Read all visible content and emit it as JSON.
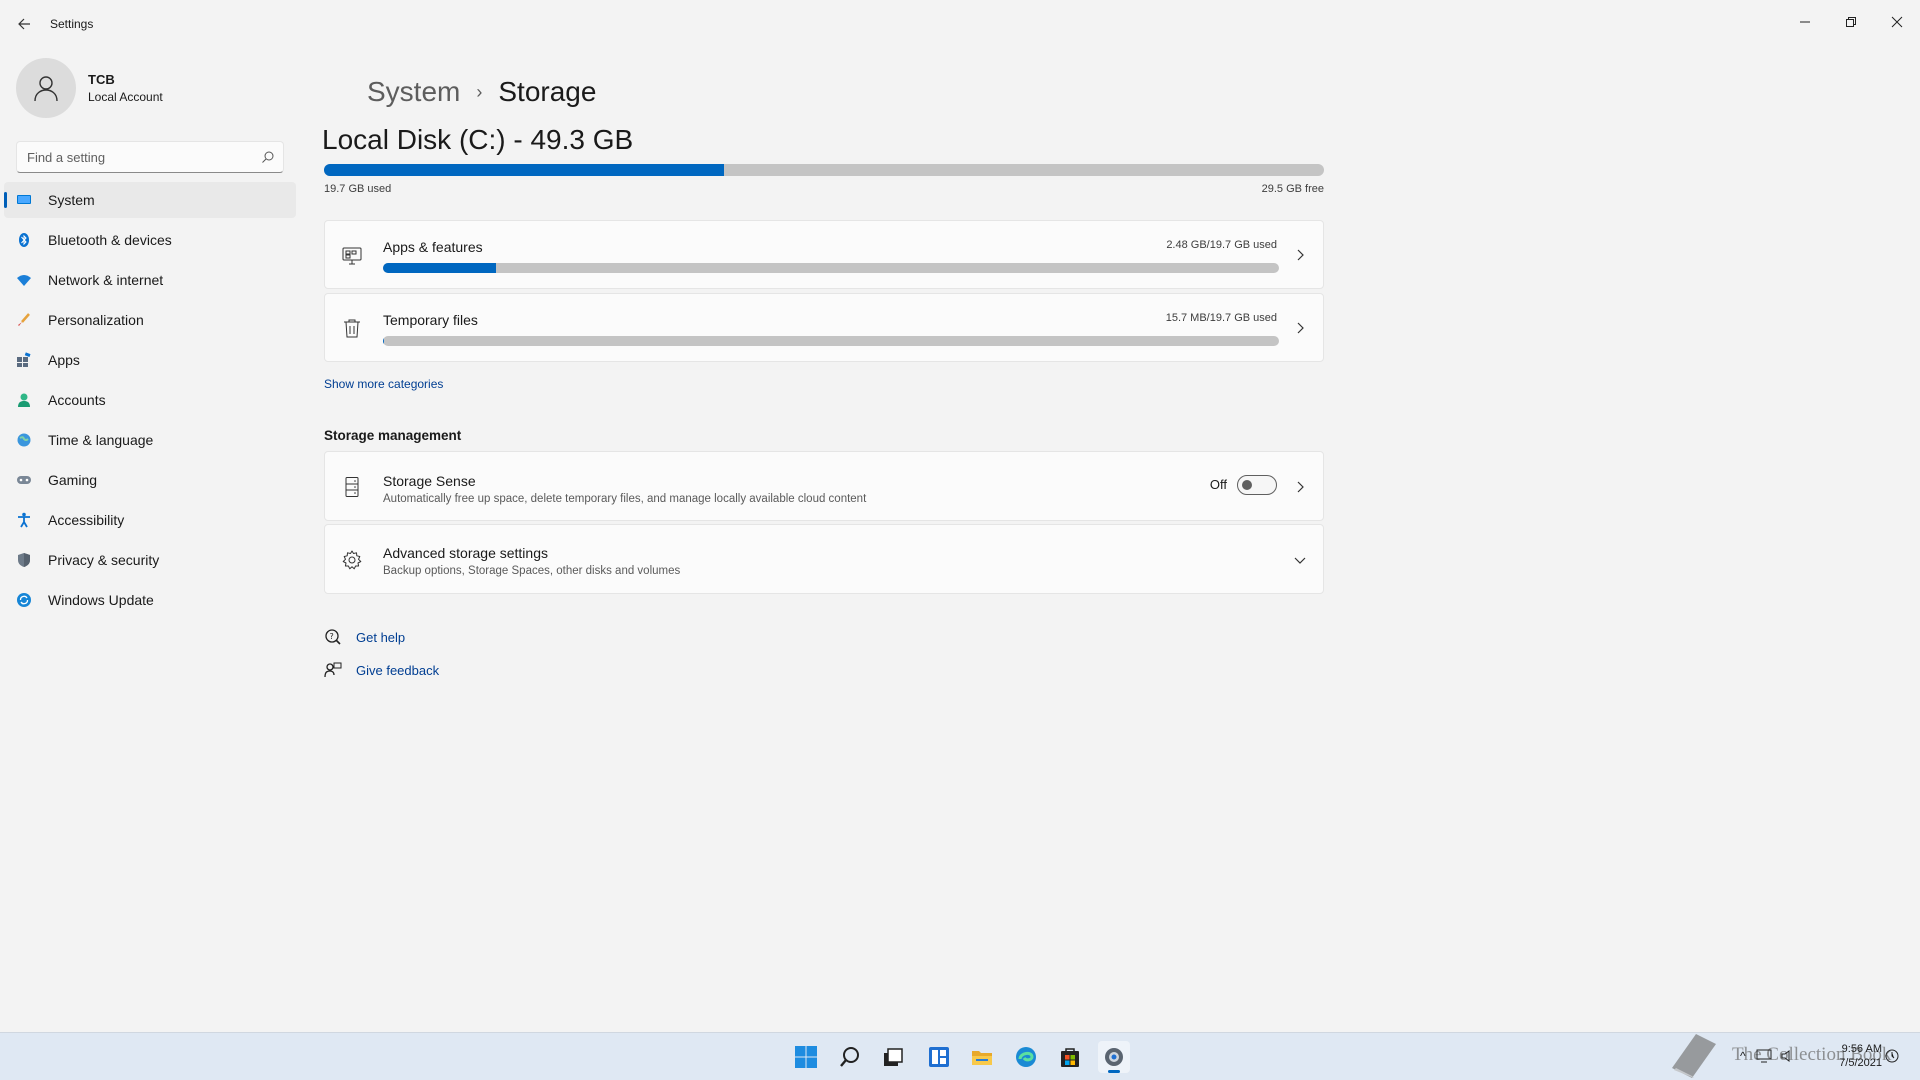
{
  "window": {
    "title": "Settings",
    "icons": {
      "back": "back-arrow-icon",
      "minimize": "minimize-icon",
      "maximize": "restore-icon",
      "close": "close-icon"
    }
  },
  "profile": {
    "name": "TCB",
    "account_type": "Local Account"
  },
  "search": {
    "placeholder": "Find a setting"
  },
  "sidebar": {
    "items": [
      {
        "label": "System",
        "icon": "system-icon",
        "active": true
      },
      {
        "label": "Bluetooth & devices",
        "icon": "bluetooth-icon"
      },
      {
        "label": "Network & internet",
        "icon": "wifi-icon"
      },
      {
        "label": "Personalization",
        "icon": "brush-icon"
      },
      {
        "label": "Apps",
        "icon": "apps-icon"
      },
      {
        "label": "Accounts",
        "icon": "person-icon"
      },
      {
        "label": "Time & language",
        "icon": "globe-icon"
      },
      {
        "label": "Gaming",
        "icon": "gamepad-icon"
      },
      {
        "label": "Accessibility",
        "icon": "accessibility-icon"
      },
      {
        "label": "Privacy & security",
        "icon": "shield-icon"
      },
      {
        "label": "Windows Update",
        "icon": "update-icon"
      }
    ]
  },
  "breadcrumb": {
    "parent": "System",
    "separator": "›",
    "current": "Storage"
  },
  "disk": {
    "title": "Local Disk (C:) - 49.3 GB",
    "used_label": "19.7 GB used",
    "free_label": "29.5 GB free",
    "used_fraction": 0.4
  },
  "categories": [
    {
      "title": "Apps & features",
      "usage": "2.48 GB/19.7 GB used",
      "fraction": 0.126,
      "icon": "apps-features-icon"
    },
    {
      "title": "Temporary files",
      "usage": "15.7 MB/19.7 GB used",
      "fraction": 0.001,
      "icon": "trash-icon"
    }
  ],
  "show_more": "Show more categories",
  "storage_management": {
    "heading": "Storage management",
    "storage_sense": {
      "title": "Storage Sense",
      "description": "Automatically free up space, delete temporary files, and manage locally available cloud content",
      "toggle_label": "Off",
      "toggle_on": false
    },
    "advanced": {
      "title": "Advanced storage settings",
      "description": "Backup options, Storage Spaces, other disks and volumes"
    }
  },
  "help": {
    "get_help": "Get help",
    "give_feedback": "Give feedback"
  },
  "taskbar": {
    "icons": [
      "start-icon",
      "search-icon",
      "task-view-icon",
      "widgets-icon",
      "file-explorer-icon",
      "edge-icon",
      "store-icon",
      "settings-icon"
    ],
    "active": "settings-icon",
    "time": "9:56 AM",
    "date": "7/5/2021"
  },
  "watermark": {
    "text": "The Collection Book"
  },
  "colors": {
    "accent": "#0067c0",
    "background": "#f3f3f3",
    "card": "#fbfbfb",
    "link": "#003e92"
  }
}
